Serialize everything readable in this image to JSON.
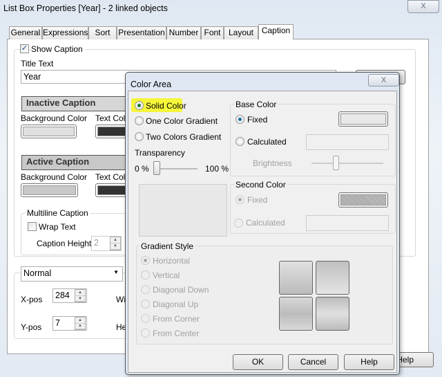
{
  "window": {
    "title": "List Box Properties [Year] - 2 linked objects",
    "close": "X"
  },
  "tabs": [
    "General",
    "Expressions",
    "Sort",
    "Presentation",
    "Number",
    "Font",
    "Layout",
    "Caption"
  ],
  "caption": {
    "show_caption": "Show Caption",
    "show_caption_checked": true,
    "title_text_label": "Title Text",
    "title_text_value": "Year",
    "inactive_header": "Inactive Caption",
    "active_header": "Active Caption",
    "bg_color": "Background Color",
    "text_color": "Text Colo",
    "multiline": "Multiline Caption",
    "wrap_text": "Wrap Text",
    "wrap_checked": false,
    "caption_height_label": "Caption Height",
    "caption_height": "2",
    "mode": "Normal",
    "xpos_label": "X-pos",
    "xpos": "284",
    "ypos_label": "Y-pos",
    "ypos": "7",
    "width_label": "Wi",
    "height_label": "He",
    "help": "Help"
  },
  "dialog": {
    "title": "Color Area",
    "close": "X",
    "fill_options": [
      "Solid Color",
      "One Color Gradient",
      "Two Colors Gradient"
    ],
    "selected_fill": "Solid Color",
    "transparency": "Transparency",
    "min": "0 %",
    "max": "100 %",
    "transparency_value": 0,
    "base_color": {
      "legend": "Base Color",
      "fixed": "Fixed",
      "calculated": "Calculated",
      "brightness": "Brightness"
    },
    "second_color": {
      "legend": "Second Color",
      "fixed": "Fixed",
      "calculated": "Calculated"
    },
    "gradient_style": {
      "legend": "Gradient Style",
      "options": [
        "Horizontal",
        "Vertical",
        "Diagonal Down",
        "Diagonal Up",
        "From Corner",
        "From Center"
      ],
      "selected": "Horizontal"
    },
    "buttons": {
      "ok": "OK",
      "cancel": "Cancel",
      "help": "Help"
    },
    "highlight_color": "#f5f53a"
  }
}
